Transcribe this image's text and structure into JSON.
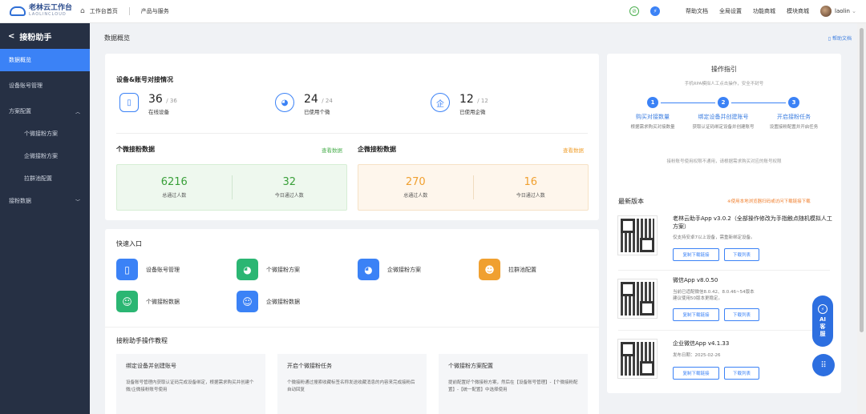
{
  "topbar": {
    "logo_cn": "老林云工作台",
    "logo_en": "LAOLINCLOUD",
    "home": "工作台首页",
    "products": "产品与服务",
    "help_docs": "帮助文档",
    "global_settings": "全局设置",
    "func_mall": "功能商城",
    "module_mall": "模块商城",
    "user": "laolin"
  },
  "sidebar": {
    "title": "接粉助手",
    "items": [
      {
        "label": "数据概览"
      },
      {
        "label": "设备账号管理"
      },
      {
        "label": "方案配置"
      },
      {
        "label": "个微接粉方案"
      },
      {
        "label": "企微接粉方案"
      },
      {
        "label": "拉群池配置"
      },
      {
        "label": "接粉数据"
      }
    ]
  },
  "page": {
    "title": "数据概览",
    "help": "帮助文档"
  },
  "overview": {
    "title": "设备&账号对接情况",
    "stats": [
      {
        "value": "36",
        "total": "/ 36",
        "label": "在线设备"
      },
      {
        "value": "24",
        "total": "/ 24",
        "label": "已使用个微"
      },
      {
        "value": "12",
        "total": "/ 12",
        "label": "已使用企微"
      }
    ],
    "personal": {
      "title": "个微接粉数据",
      "link": "查看数据",
      "total_value": "6216",
      "total_label": "总通过人数",
      "today_value": "32",
      "today_label": "今日通过人数"
    },
    "enterprise": {
      "title": "企微接粉数据",
      "link": "查看数据",
      "total_value": "270",
      "total_label": "总通过人数",
      "today_value": "16",
      "today_label": "今日通过人数"
    }
  },
  "quick": {
    "title": "快速入口",
    "items": [
      {
        "label": "设备账号管理"
      },
      {
        "label": "个微接粉方案"
      },
      {
        "label": "企微接粉方案"
      },
      {
        "label": "拉群池配置"
      },
      {
        "label": "个微接粉数据"
      },
      {
        "label": "企微接粉数据"
      }
    ]
  },
  "tutorial": {
    "title": "接粉助手操作教程",
    "items": [
      {
        "title": "绑定设备并创建账号",
        "desc": "设备账号管理内获取认证码完成设备绑定，根据需求购买并创建个微/企微接粉账号使用"
      },
      {
        "title": "开启个微接粉任务",
        "desc": "个微接粉通过搜索收藏标签名称发送收藏消息的内容来完成接粉后自动回复"
      },
      {
        "title": "个微接粉方案配置",
        "desc": "提前配置好个微接粉方案，然后在【设备账号管理】-【个微接粉配置】-【统一配置】中选择使用"
      }
    ]
  },
  "guide": {
    "title": "操作指引",
    "subtitle": "手机RPA模拟人工点击操作，安全不封号",
    "steps": [
      {
        "num": "1",
        "label": "购买对接数量",
        "desc": "根据需求购买对接数量"
      },
      {
        "num": "2",
        "label": "绑定设备并创建账号",
        "desc": "获取认证码绑定设备并创建账号"
      },
      {
        "num": "3",
        "label": "开启接粉任务",
        "desc": "设置接粉配置并开启任务"
      }
    ],
    "note": "接粉账号使用权限不通用，请根据需求购买对应的账号权限"
  },
  "versions": {
    "title": "最新版本",
    "hint": "※使用本地浏览器扫码或访问下载链接下载",
    "items": [
      {
        "name": "老林云助手App v3.0.2（全部操作修改为手指触点随机模拟人工方案）",
        "desc": "仅支持安卓7以上设备，需重新绑定设备。",
        "btn1": "复制下载链接",
        "btn2": "下载列表"
      },
      {
        "name": "微信App v8.0.50",
        "desc": "当前已适配微信8.0.42、8.0.46~54版本\n建议使用50版本更稳定。",
        "btn1": "复制下载链接",
        "btn2": "下载列表"
      },
      {
        "name": "企业微信App v4.1.33",
        "desc": "发布日期：2025-02-26",
        "btn1": "复制下载链接",
        "btn2": "下载列表"
      }
    ]
  },
  "float": {
    "ai_label": "AI\n客\n服"
  },
  "colors": {
    "primary": "#3b82f6",
    "green": "#4caf50",
    "orange": "#f0a030",
    "sidebar_bg": "#263044"
  }
}
